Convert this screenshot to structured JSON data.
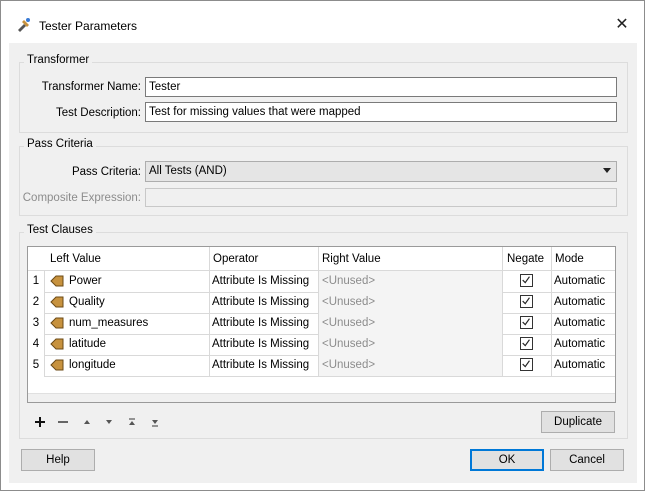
{
  "window": {
    "title": "Tester Parameters",
    "close_glyph": "✕"
  },
  "transformer": {
    "group_label": "Transformer",
    "name_label": "Transformer Name:",
    "name_value": "Tester",
    "desc_label": "Test Description:",
    "desc_value": "Test for missing values that were mapped"
  },
  "pass_criteria": {
    "group_label": "Pass Criteria",
    "criteria_label": "Pass Criteria:",
    "criteria_value": "All Tests (AND)",
    "composite_label": "Composite Expression:",
    "composite_value": ""
  },
  "test_clauses": {
    "group_label": "Test Clauses",
    "columns": [
      "Left Value",
      "Operator",
      "Right Value",
      "Negate",
      "Mode"
    ],
    "rows": [
      {
        "num": "1",
        "left": "Power",
        "operator": "Attribute Is Missing",
        "right": "<Unused>",
        "negate": true,
        "mode": "Automatic"
      },
      {
        "num": "2",
        "left": "Quality",
        "operator": "Attribute Is Missing",
        "right": "<Unused>",
        "negate": true,
        "mode": "Automatic"
      },
      {
        "num": "3",
        "left": "num_measures",
        "operator": "Attribute Is Missing",
        "right": "<Unused>",
        "negate": true,
        "mode": "Automatic"
      },
      {
        "num": "4",
        "left": "latitude",
        "operator": "Attribute Is Missing",
        "right": "<Unused>",
        "negate": true,
        "mode": "Automatic"
      },
      {
        "num": "5",
        "left": "longitude",
        "operator": "Attribute Is Missing",
        "right": "<Unused>",
        "negate": true,
        "mode": "Automatic"
      }
    ],
    "toolbar_icons": [
      "add-icon",
      "remove-icon",
      "move-up-icon",
      "move-down-icon",
      "move-top-icon",
      "move-bottom-icon"
    ],
    "duplicate_label": "Duplicate"
  },
  "footer": {
    "help_label": "Help",
    "ok_label": "OK",
    "cancel_label": "Cancel"
  },
  "colors": {
    "accent": "#0078d7",
    "attribute_icon": "#c7923e"
  }
}
